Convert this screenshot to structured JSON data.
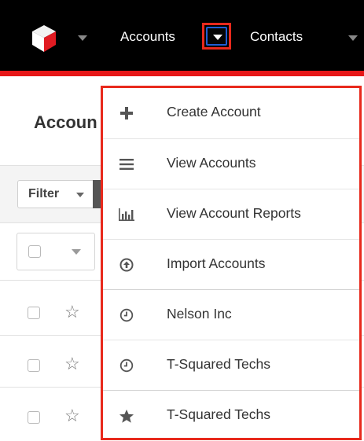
{
  "nav": {
    "items": [
      {
        "label": "Accounts"
      },
      {
        "label": "Contacts"
      }
    ]
  },
  "page": {
    "title": "Accoun"
  },
  "toolbar": {
    "filter_label": "Filter"
  },
  "dropdown": {
    "items": [
      {
        "label": "Create Account",
        "icon": "plus-icon"
      },
      {
        "label": "View Accounts",
        "icon": "list-icon"
      },
      {
        "label": "View Account Reports",
        "icon": "bar-chart-icon"
      },
      {
        "label": "Import Accounts",
        "icon": "upload-circle-icon"
      },
      {
        "label": "Nelson Inc",
        "icon": "clock-icon"
      },
      {
        "label": "T-Squared Techs",
        "icon": "clock-icon"
      },
      {
        "label": "T-Squared Techs",
        "icon": "star-icon"
      }
    ]
  },
  "colors": {
    "highlight": "#e8291c",
    "focus": "#1f5fd4",
    "topbar": "#000000",
    "brand_red": "#e61718"
  }
}
